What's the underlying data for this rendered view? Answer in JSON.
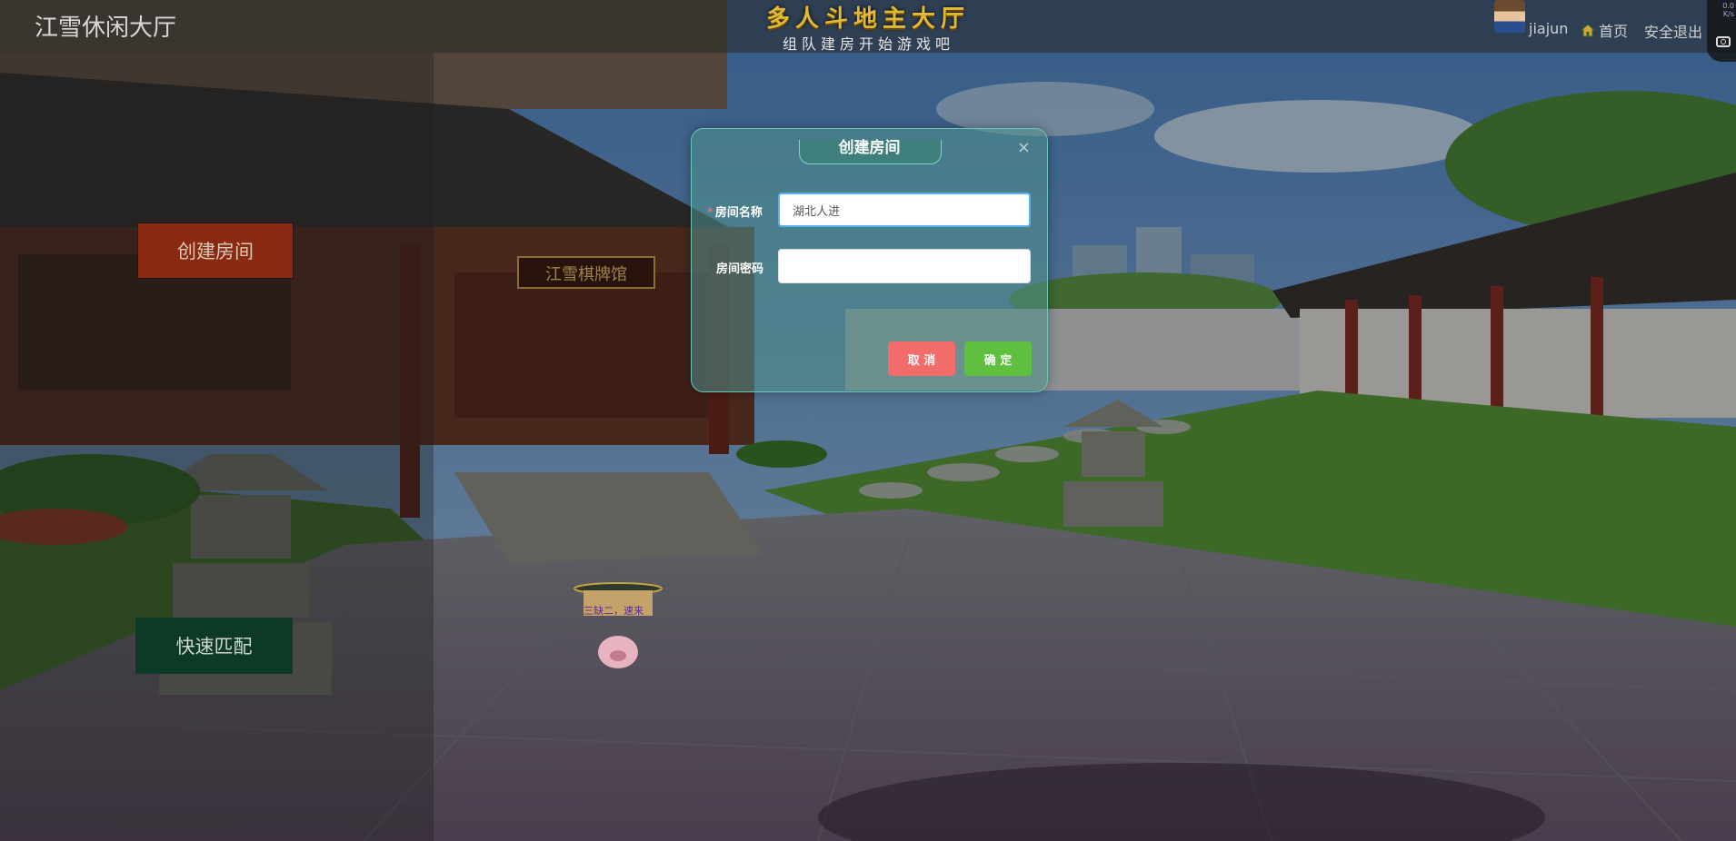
{
  "header": {
    "brand": "江雪休闲大厅",
    "hall_title": "多人斗地主大厅",
    "hall_subtitle": "组队建房开始游戏吧",
    "username": "jiajun",
    "home_label": "首页",
    "logout_label": "安全退出",
    "speed_value": "0.0",
    "speed_unit": "K/s"
  },
  "sidebar": {
    "create_room_label": "创建房间",
    "quick_match_label": "快速匹配"
  },
  "scene": {
    "signboard_text": "江雪棋牌馆",
    "table_label": "三缺二，速来"
  },
  "modal": {
    "title": "创建房间",
    "close_symbol": "×",
    "room_name_required": "*",
    "room_name_label": "房间名称",
    "room_name_value": "湖北人进",
    "room_password_label": "房间密码",
    "room_password_value": "",
    "cancel_label": "取 消",
    "confirm_label": "确 定"
  },
  "colors": {
    "create_button": "#8a2a12",
    "quick_match_button": "#0d3a26",
    "cancel_button": "#f26c6c",
    "confirm_button": "#5ec03e",
    "hall_title": "#e0b83a"
  },
  "icons": [
    "home-icon",
    "camera-icon",
    "close-icon",
    "avatar"
  ]
}
